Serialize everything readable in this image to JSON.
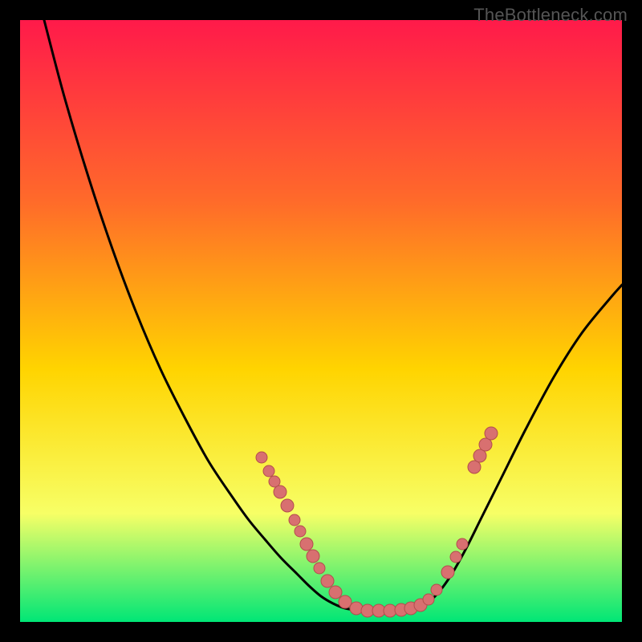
{
  "watermark": "TheBottleneck.com",
  "colors": {
    "frame": "#000000",
    "gradient_top": "#ff1a4a",
    "gradient_mid1": "#ff6a2a",
    "gradient_mid2": "#ffd400",
    "gradient_mid3": "#f7ff66",
    "gradient_bottom": "#00e676",
    "curve": "#000000",
    "dot_fill": "#d87070",
    "dot_stroke": "#b34d4d"
  },
  "chart_data": {
    "type": "line",
    "title": "",
    "xlabel": "",
    "ylabel": "",
    "xlim": [
      25,
      775
    ],
    "ylim": [
      775,
      25
    ],
    "grid": false,
    "annotations": [],
    "series": [
      {
        "name": "left-branch",
        "x": [
          55,
          80,
          110,
          140,
          170,
          200,
          230,
          260,
          290,
          310,
          330,
          350,
          370,
          385,
          400,
          415,
          430
        ],
        "y": [
          25,
          120,
          220,
          310,
          390,
          460,
          520,
          575,
          620,
          648,
          672,
          695,
          715,
          730,
          743,
          752,
          758
        ]
      },
      {
        "name": "valley-floor",
        "x": [
          430,
          445,
          460,
          475,
          490,
          505,
          520
        ],
        "y": [
          758,
          760,
          761,
          761,
          761,
          760,
          757
        ]
      },
      {
        "name": "right-branch",
        "x": [
          520,
          540,
          560,
          580,
          600,
          625,
          655,
          690,
          725,
          760,
          775
        ],
        "y": [
          757,
          745,
          720,
          685,
          645,
          595,
          535,
          470,
          415,
          372,
          355
        ]
      }
    ],
    "dots": {
      "name": "data-points",
      "points": [
        {
          "x": 326,
          "y": 570,
          "r": 7
        },
        {
          "x": 335,
          "y": 587,
          "r": 7
        },
        {
          "x": 342,
          "y": 600,
          "r": 7
        },
        {
          "x": 349,
          "y": 613,
          "r": 8
        },
        {
          "x": 358,
          "y": 630,
          "r": 8
        },
        {
          "x": 367,
          "y": 648,
          "r": 7
        },
        {
          "x": 374,
          "y": 662,
          "r": 7
        },
        {
          "x": 382,
          "y": 678,
          "r": 8
        },
        {
          "x": 390,
          "y": 693,
          "r": 8
        },
        {
          "x": 398,
          "y": 708,
          "r": 7
        },
        {
          "x": 408,
          "y": 724,
          "r": 8
        },
        {
          "x": 418,
          "y": 738,
          "r": 8
        },
        {
          "x": 430,
          "y": 750,
          "r": 8
        },
        {
          "x": 444,
          "y": 758,
          "r": 8
        },
        {
          "x": 458,
          "y": 761,
          "r": 8
        },
        {
          "x": 472,
          "y": 761,
          "r": 8
        },
        {
          "x": 486,
          "y": 761,
          "r": 8
        },
        {
          "x": 500,
          "y": 760,
          "r": 8
        },
        {
          "x": 512,
          "y": 758,
          "r": 8
        },
        {
          "x": 524,
          "y": 754,
          "r": 8
        },
        {
          "x": 534,
          "y": 747,
          "r": 7
        },
        {
          "x": 544,
          "y": 735,
          "r": 7
        },
        {
          "x": 558,
          "y": 713,
          "r": 8
        },
        {
          "x": 568,
          "y": 694,
          "r": 7
        },
        {
          "x": 576,
          "y": 678,
          "r": 7
        },
        {
          "x": 591,
          "y": 582,
          "r": 8
        },
        {
          "x": 598,
          "y": 568,
          "r": 8
        },
        {
          "x": 605,
          "y": 554,
          "r": 8
        },
        {
          "x": 612,
          "y": 540,
          "r": 8
        }
      ]
    }
  }
}
